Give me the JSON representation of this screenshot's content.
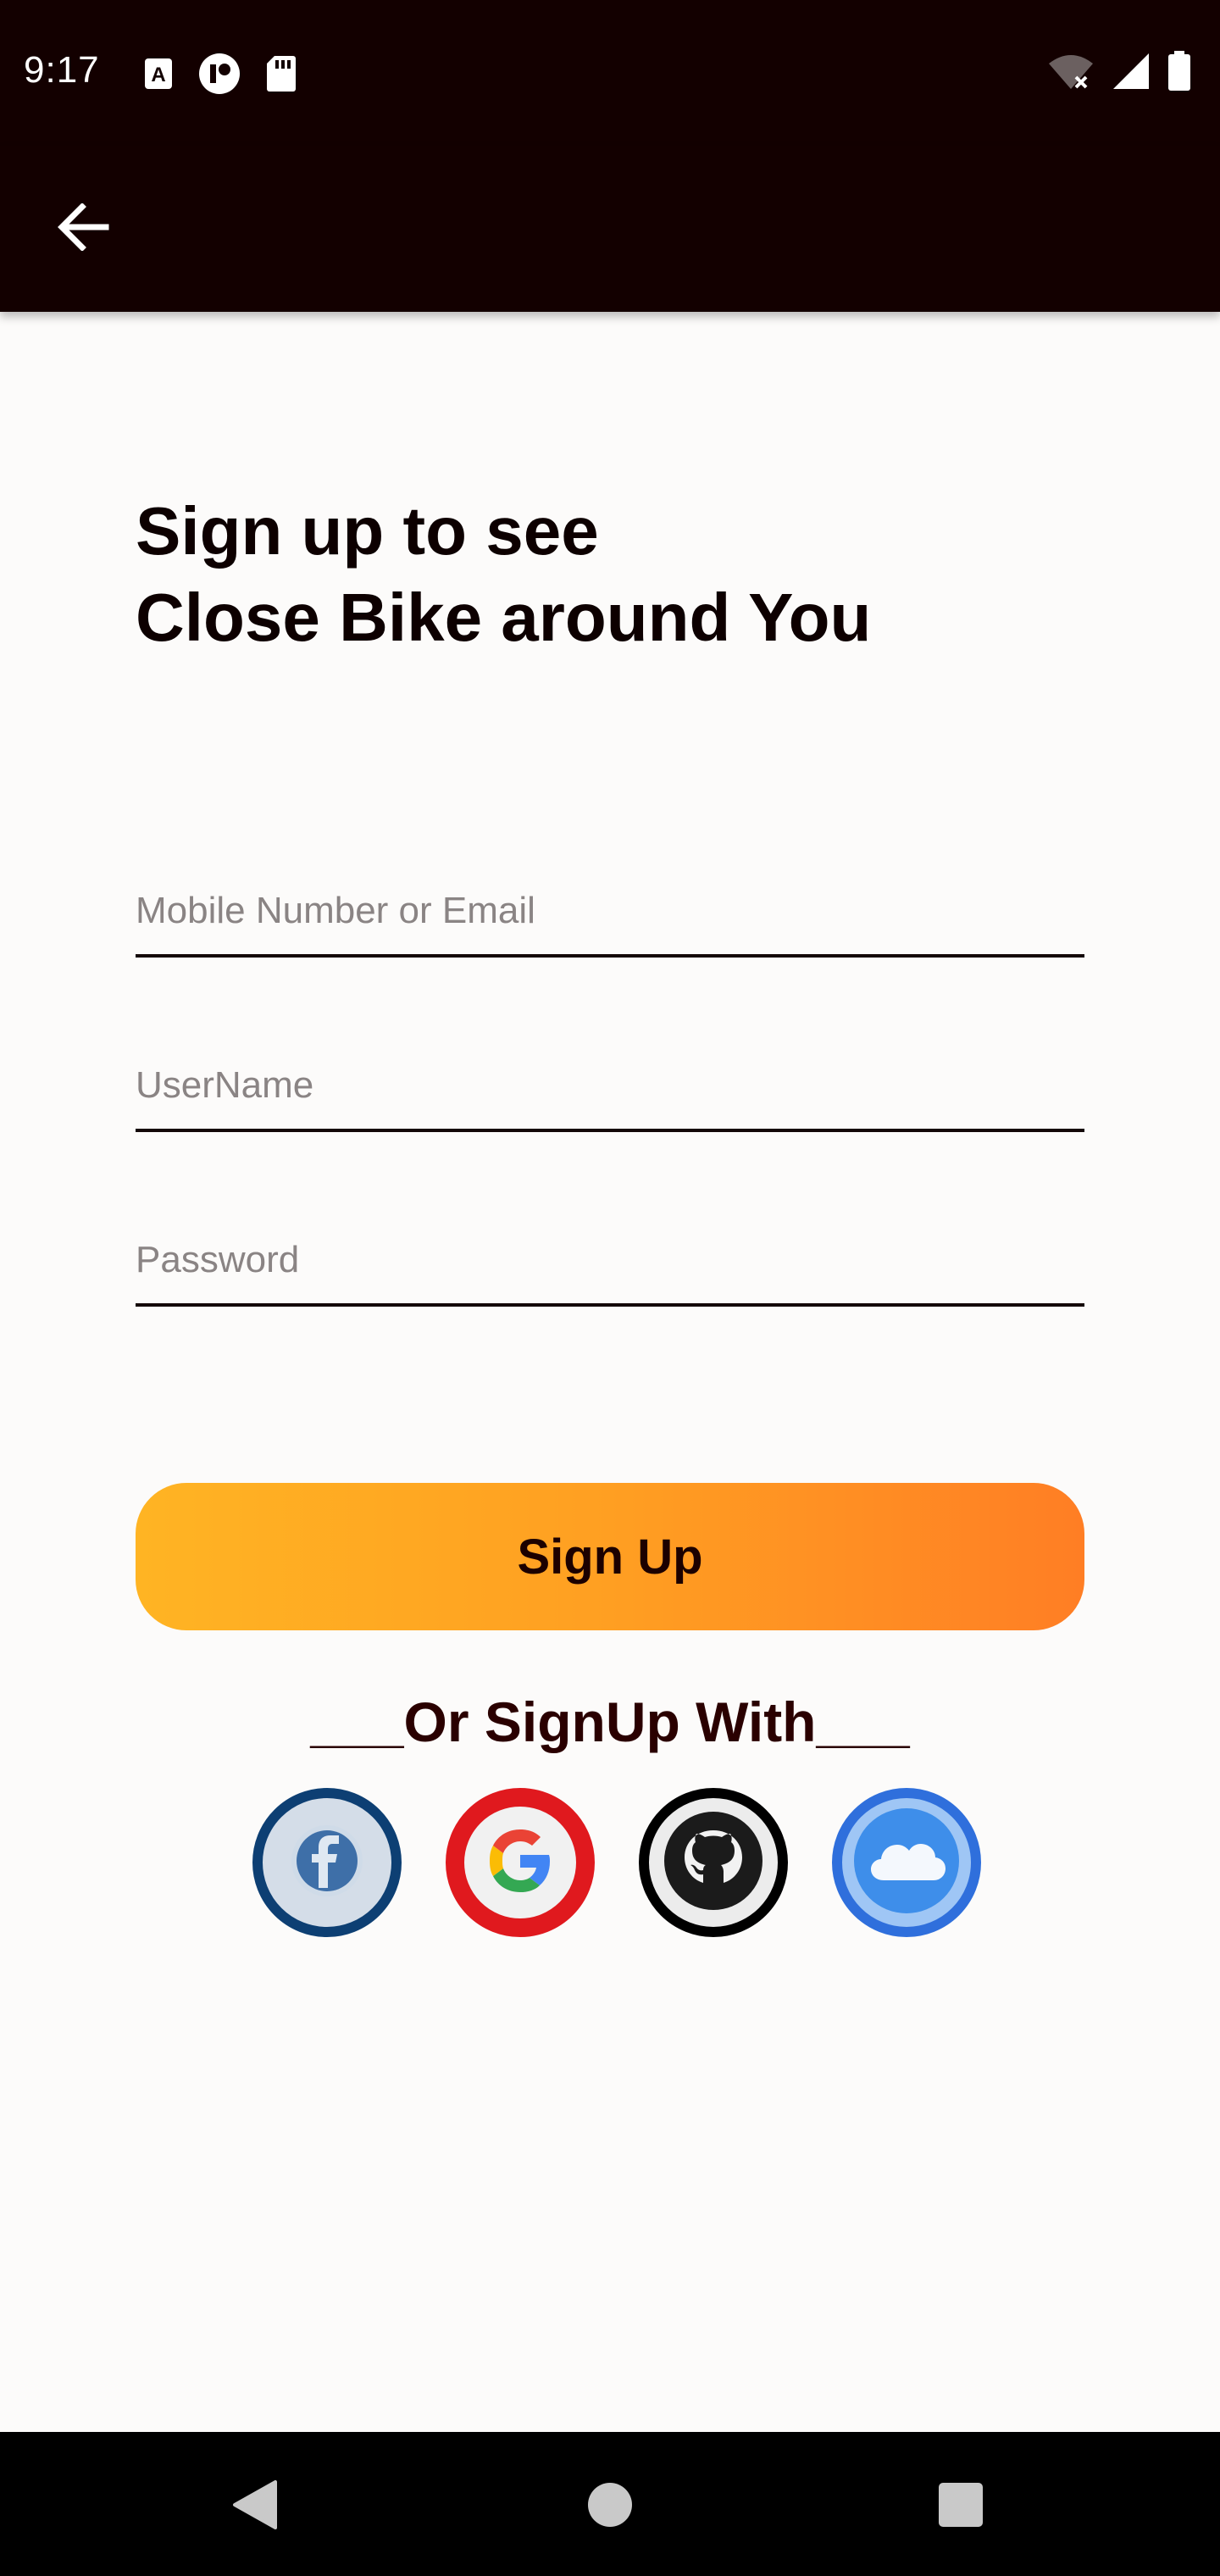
{
  "status_bar": {
    "time": "9:17",
    "left_icons": [
      "text-input-icon",
      "account-icon",
      "sd-card-icon"
    ],
    "right_icons": [
      "wifi-off-icon",
      "cell-signal-icon",
      "battery-icon"
    ]
  },
  "app_bar": {
    "back_icon": "arrow-back-icon"
  },
  "headline": {
    "line1": "Sign up to see",
    "line2": "Close Bike around You"
  },
  "form": {
    "mobile_placeholder": "Mobile Number or Email",
    "username_placeholder": "UserName",
    "password_placeholder": "Password",
    "mobile_value": "",
    "username_value": "",
    "password_value": ""
  },
  "signup_button": {
    "label": "Sign Up"
  },
  "social": {
    "divider_text": "___Or SignUp With___",
    "providers": [
      {
        "icon": "facebook-icon",
        "ring_color": "#0d3f73"
      },
      {
        "icon": "google-icon",
        "ring_color": "#e0191e"
      },
      {
        "icon": "github-icon",
        "ring_color": "#000000"
      },
      {
        "icon": "cloud-icon",
        "ring_color": "#2f6fdc"
      }
    ]
  },
  "nav_bar": {
    "icons": [
      "back-triangle-icon",
      "home-circle-icon",
      "recents-square-icon"
    ]
  },
  "colors": {
    "bar_bg": "#130000",
    "page_bg": "#fcfbfa",
    "button_gradient_start": "#ffb423",
    "button_gradient_end": "#ff7e24",
    "text_dark": "#0d0000"
  }
}
